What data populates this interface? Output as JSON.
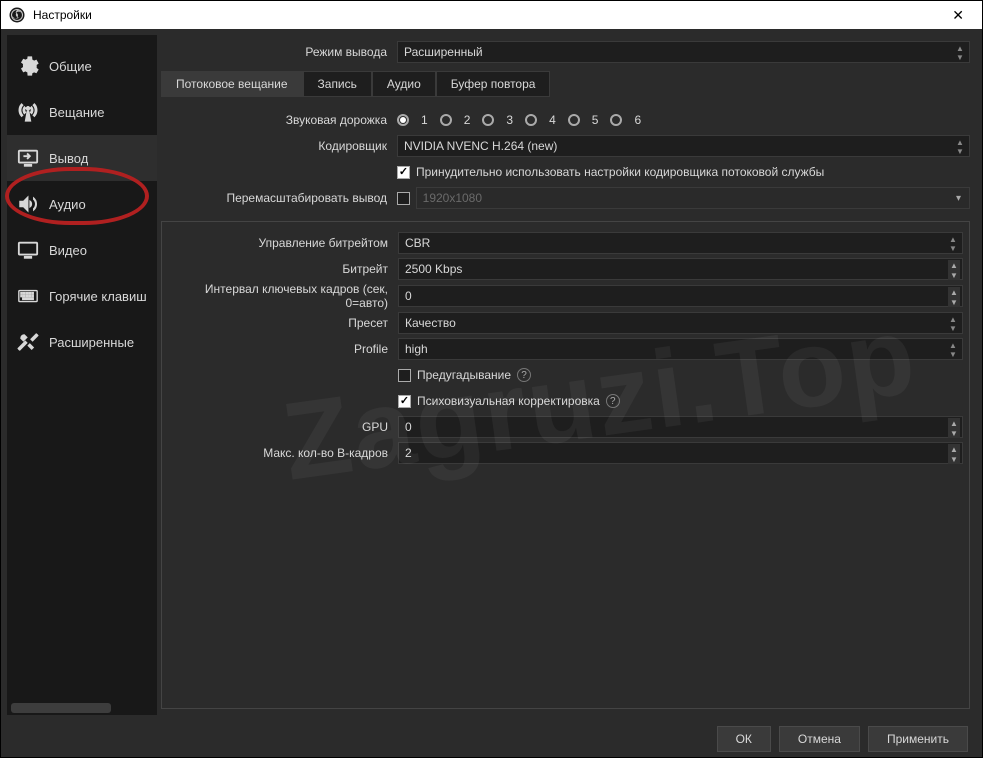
{
  "window": {
    "title": "Настройки"
  },
  "sidebar": {
    "items": [
      {
        "key": "general",
        "label": "Общие"
      },
      {
        "key": "stream",
        "label": "Вещание"
      },
      {
        "key": "output",
        "label": "Вывод"
      },
      {
        "key": "audio",
        "label": "Аудио"
      },
      {
        "key": "video",
        "label": "Видео"
      },
      {
        "key": "hotkeys",
        "label": "Горячие клавиш"
      },
      {
        "key": "advanced",
        "label": "Расширенные"
      }
    ],
    "active": "output",
    "highlighted": "output"
  },
  "top": {
    "mode_label": "Режим вывода",
    "mode_value": "Расширенный"
  },
  "tabs": [
    {
      "key": "streaming",
      "label": "Потоковое вещание"
    },
    {
      "key": "recording",
      "label": "Запись"
    },
    {
      "key": "audio",
      "label": "Аудио"
    },
    {
      "key": "replay",
      "label": "Буфер повтора"
    }
  ],
  "tabs_active": "streaming",
  "streaming": {
    "track_label": "Звуковая дорожка",
    "tracks": [
      "1",
      "2",
      "3",
      "4",
      "5",
      "6"
    ],
    "track_selected": "1",
    "encoder_label": "Кодировщик",
    "encoder_value": "NVIDIA NVENC H.264 (new)",
    "enforce_label": "Принудительно использовать настройки кодировщика потоковой службы",
    "enforce_checked": true,
    "rescale_label": "Перемасштабировать вывод",
    "rescale_checked": false,
    "rescale_value": "1920x1080"
  },
  "encoder": {
    "rate_control_label": "Управление битрейтом",
    "rate_control_value": "CBR",
    "bitrate_label": "Битрейт",
    "bitrate_value": "2500 Kbps",
    "keyint_label": "Интервал ключевых кадров (сек, 0=авто)",
    "keyint_value": "0",
    "preset_label": "Пресет",
    "preset_value": "Качество",
    "profile_label": "Profile",
    "profile_value": "high",
    "lookahead_label": "Предугадывание",
    "lookahead_checked": false,
    "psycho_label": "Психовизуальная корректировка",
    "psycho_checked": true,
    "gpu_label": "GPU",
    "gpu_value": "0",
    "bframes_label": "Макс. кол-во B-кадров",
    "bframes_value": "2"
  },
  "footer": {
    "ok": "ОК",
    "cancel": "Отмена",
    "apply": "Применить"
  },
  "watermark": "Zagruzi.Top"
}
